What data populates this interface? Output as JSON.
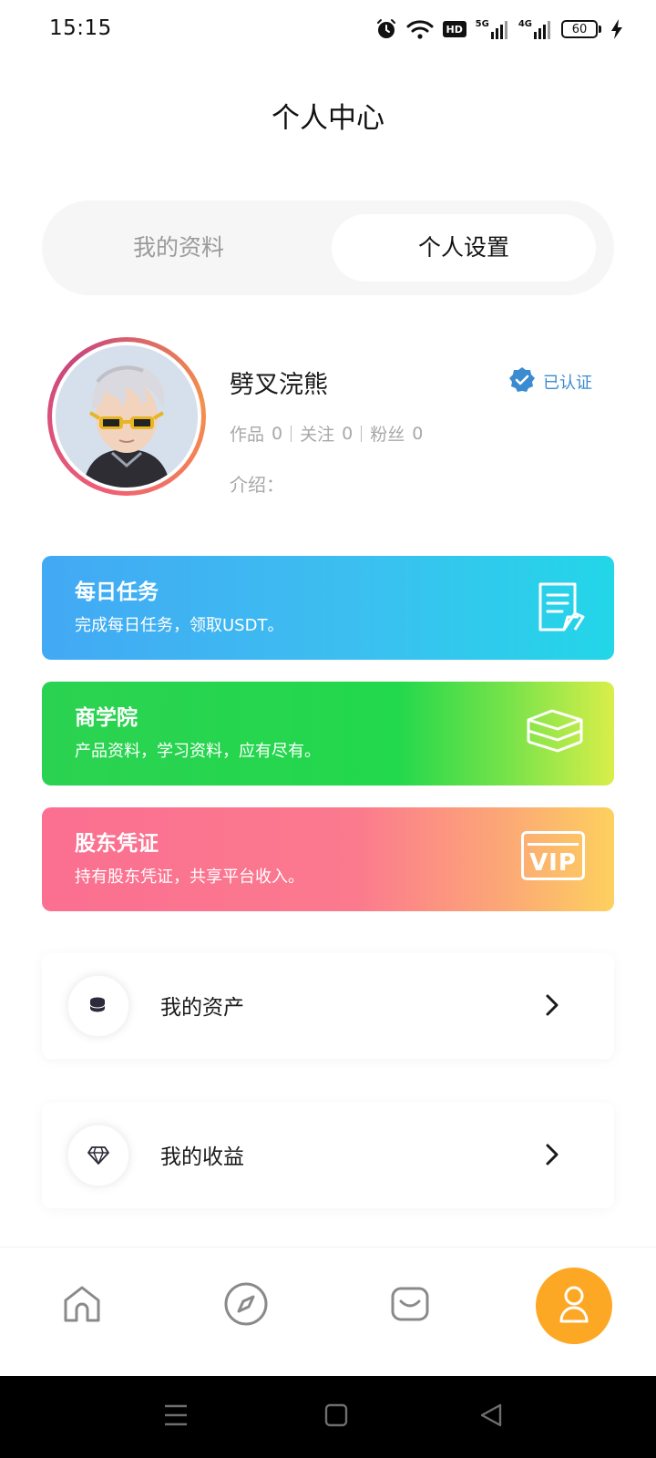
{
  "status_bar": {
    "time": "15:15",
    "network_5g": "5G",
    "network_4g": "4G",
    "hd": "HD",
    "battery": "60",
    "icons": [
      "alarm-icon",
      "wifi-icon",
      "hd-icon",
      "signal-5g-icon",
      "signal-4g-icon",
      "battery-icon",
      "charging-icon"
    ]
  },
  "header": {
    "title": "个人中心"
  },
  "segmented": {
    "tabs": [
      {
        "label": "我的资料",
        "active": false
      },
      {
        "label": "个人设置",
        "active": true
      }
    ]
  },
  "profile": {
    "name": "劈叉浣熊",
    "verified_label": "已认证",
    "stats": [
      {
        "label": "作品",
        "value": "0"
      },
      {
        "label": "关注",
        "value": "0"
      },
      {
        "label": "粉丝",
        "value": "0"
      }
    ],
    "intro_label": "介绍："
  },
  "feature_cards": [
    {
      "title": "每日任务",
      "desc": "完成每日任务，领取USDT。",
      "icon": "document-icon"
    },
    {
      "title": "商学院",
      "desc": "产品资料，学习资料，应有尽有。",
      "icon": "layers-icon"
    },
    {
      "title": "股东凭证",
      "desc": "持有股东凭证，共享平台收入。",
      "icon": "vip-card-icon",
      "icon_text": "VIP"
    }
  ],
  "menu": [
    {
      "label": "我的资产",
      "icon": "coins-icon"
    },
    {
      "label": "我的收益",
      "icon": "diamond-icon"
    }
  ],
  "tabbar": {
    "items": [
      {
        "name": "home",
        "icon": "home-icon",
        "active": false
      },
      {
        "name": "discover",
        "icon": "compass-icon",
        "active": false
      },
      {
        "name": "messages",
        "icon": "message-icon",
        "active": false
      },
      {
        "name": "me",
        "icon": "user-icon",
        "active": true
      }
    ],
    "active_color": "#fda825"
  },
  "colors": {
    "accent_orange": "#fda825",
    "verify_blue": "#3b8bd0",
    "card_tasks": "#3cbff0",
    "card_academy": "#22d84c",
    "card_voucher": "#fb7a8e"
  }
}
